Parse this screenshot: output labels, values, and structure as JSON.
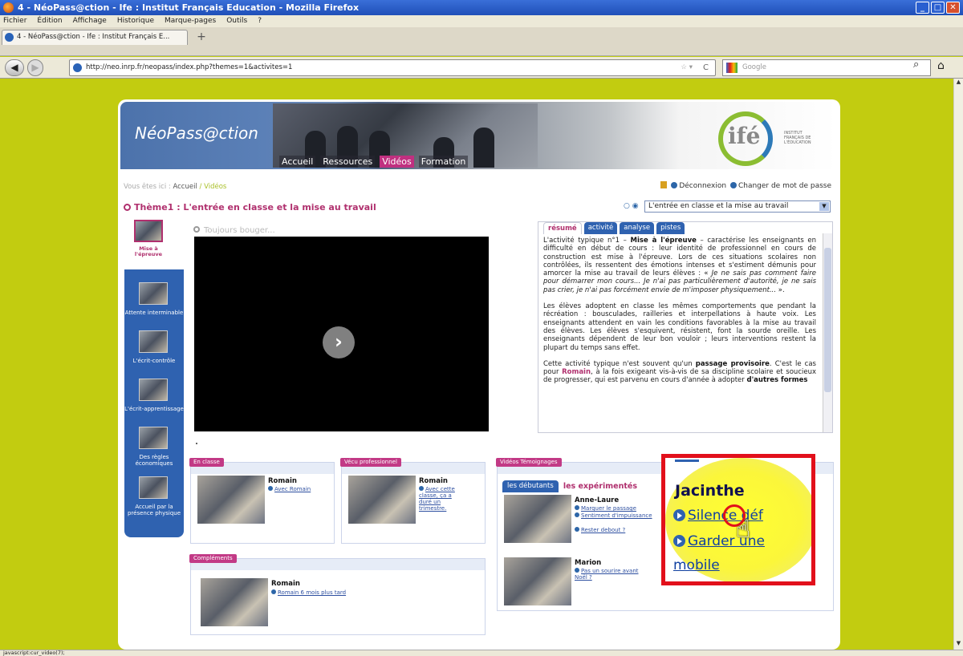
{
  "window": {
    "title": "4 - NéoPass@ction - Ife : Institut Français Education - Mozilla Firefox",
    "buttons": [
      "_",
      "□",
      "✕"
    ]
  },
  "menu": [
    "Fichier",
    "Édition",
    "Affichage",
    "Historique",
    "Marque-pages",
    "Outils",
    "?"
  ],
  "browser": {
    "tab_title": "4 - NéoPass@ction - Ife : Institut Français E...",
    "new_tab": "+",
    "url": "http://neo.inrp.fr/neopass/index.php?themes=1&activites=1",
    "search_placeholder": "Google",
    "status": "javascript:cur_video(7);"
  },
  "site": {
    "brand": "NéoPass@ction",
    "nav": [
      "Accueil",
      "Ressources",
      "Vidéos",
      "Formation"
    ],
    "nav_active": "Vidéos",
    "logo_text": "ifé",
    "logo_sub": "INSTITUT FRANÇAIS DE L'ÉDUCATION",
    "breadcrumb_prefix": "Vous êtes ici :",
    "breadcrumb_home": "Accueil",
    "breadcrumb_sep": "/",
    "breadcrumb_current": "Vidéos",
    "logout": "Déconnexion",
    "change_password": "Changer de mot de passe",
    "theme_title": "Thème1 : L'entrée en classe et la mise au travail",
    "theme_select": "L'entrée en classe et la mise au travail"
  },
  "sidebar": [
    {
      "label": "Mise à l'épreuve",
      "active": true
    },
    {
      "label": "Attente interminable"
    },
    {
      "label": "L'écrit-contrôle"
    },
    {
      "label": "L'écrit-apprentissage"
    },
    {
      "label": "Des règles économiques"
    },
    {
      "label": "Accueil par la présence physique"
    }
  ],
  "video": {
    "caption": "Toujours bouger..."
  },
  "info": {
    "tabs": [
      "résumé",
      "activité",
      "analyse",
      "pistes"
    ],
    "p1_intro": "L'activité typique n°1 – ",
    "p1_bold": "Mise à l'épreuve",
    "p1_body": " – caractérise les enseignants en difficulté en début de cours : leur identité de professionnel en cours de construction est mise à l'épreuve. Lors de ces situations scolaires non contrôlées, ils ressentent des émotions intenses et s'estiment démunis pour amorcer la mise au travail de leurs élèves : « ",
    "p1_italic": "Je ne sais pas comment faire pour démarrer mon cours... Je n'ai pas particulièrement d'autorité, je ne sais pas crier, je n'ai pas forcément envie de m'imposer physiquement...",
    "p1_end": " ».",
    "p2": "Les élèves adoptent en classe les mêmes comportements que pendant la récréation : bousculades, railleries et interpellations à haute voix. Les enseignants attendent en vain les conditions favorables à la mise au travail des élèves. Les élèves s'esquivent, résistent, font la sourde oreille. Les enseignants dépendent de leur bon vouloir ; leurs interventions restent la plupart du temps sans effet.",
    "p3_a": "Cette activité typique n'est souvent qu'un ",
    "p3_bold1": "passage provisoire",
    "p3_b": ". C'est le cas pour ",
    "p3_romain": "Romain",
    "p3_c": ", à la fois exigeant vis-à-vis de sa discipline scolaire et soucieux de progresser, qui est parvenu en cours d'année à adopter ",
    "p3_bold2": "d'autres formes"
  },
  "sections": {
    "en_classe": {
      "tag": "En classe",
      "name": "Romain",
      "link": "Avec Romain"
    },
    "vecu": {
      "tag": "Vécu professionnel",
      "name": "Romain",
      "link": "Avec cette classe, ça a duré un trimestre."
    },
    "complements": {
      "tag": "Compléments",
      "name": "Romain",
      "link": "Romain 6 mois plus tard"
    },
    "temoignages": {
      "tag": "Vidéos Témoignages",
      "tab1": "les débutants",
      "tab2": "les expérimentés",
      "p1_name": "Anne-Laure",
      "p1_links": [
        "Marquer le passage",
        "Sentiment d'impuissance",
        "Rester debout ?"
      ],
      "p2_name": "Marion",
      "p2_link": "Pas un sourire avant Noël ?"
    }
  },
  "zoom": {
    "name": "Jacinthe",
    "link1": "Silence déf",
    "link2": "Garder une",
    "link3": "mobile"
  }
}
